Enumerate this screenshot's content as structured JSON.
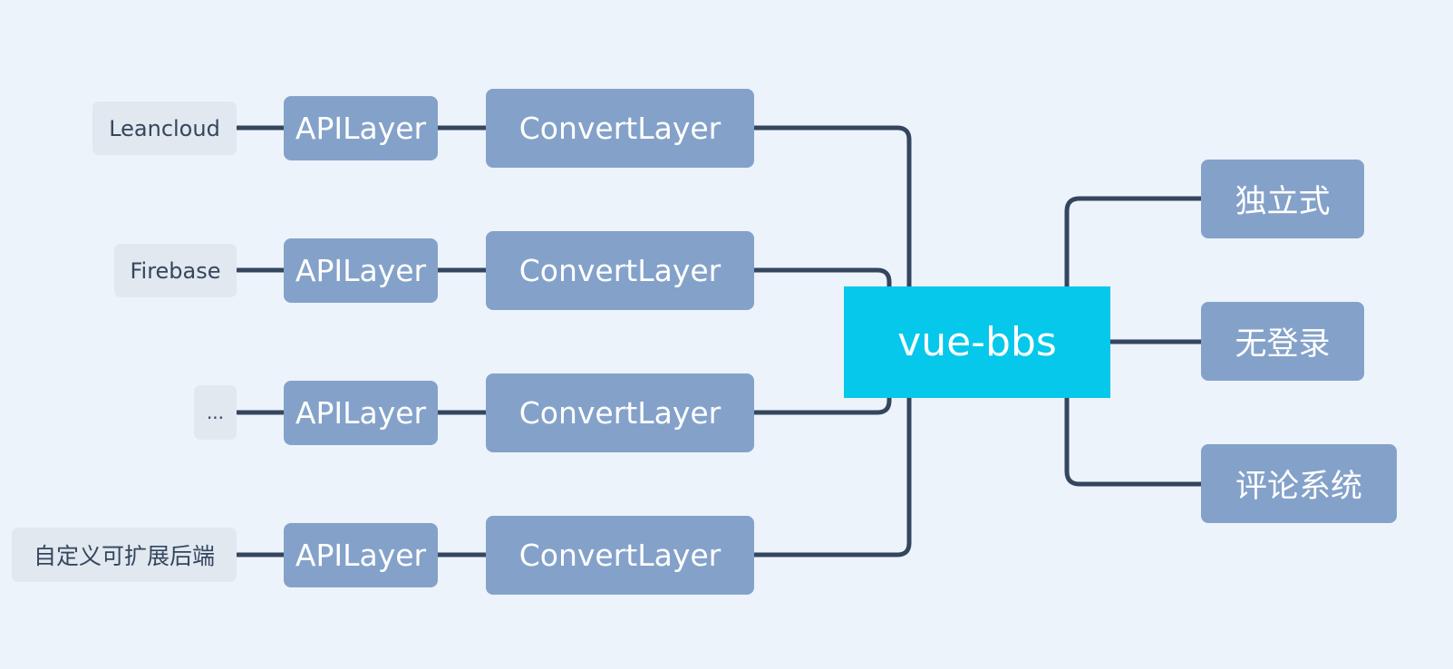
{
  "diagram": {
    "root": {
      "label": "vue-bbs",
      "color": "#05c8eb"
    },
    "left_branches": [
      {
        "backend": "Leancloud",
        "api": "APILayer",
        "convert": "ConvertLayer"
      },
      {
        "backend": "Firebase",
        "api": "APILayer",
        "convert": "ConvertLayer"
      },
      {
        "backend": "...",
        "api": "APILayer",
        "convert": "ConvertLayer"
      },
      {
        "backend": "自定义可扩展后端",
        "api": "APILayer",
        "convert": "ConvertLayer"
      }
    ],
    "right_branches": [
      {
        "label": "独立式"
      },
      {
        "label": "无登录"
      },
      {
        "label": "评论系统"
      }
    ],
    "colors": {
      "background": "#ecf3fa",
      "node": "#84a2c9",
      "leaf": "#e1e8f0",
      "line": "#34465e"
    }
  }
}
